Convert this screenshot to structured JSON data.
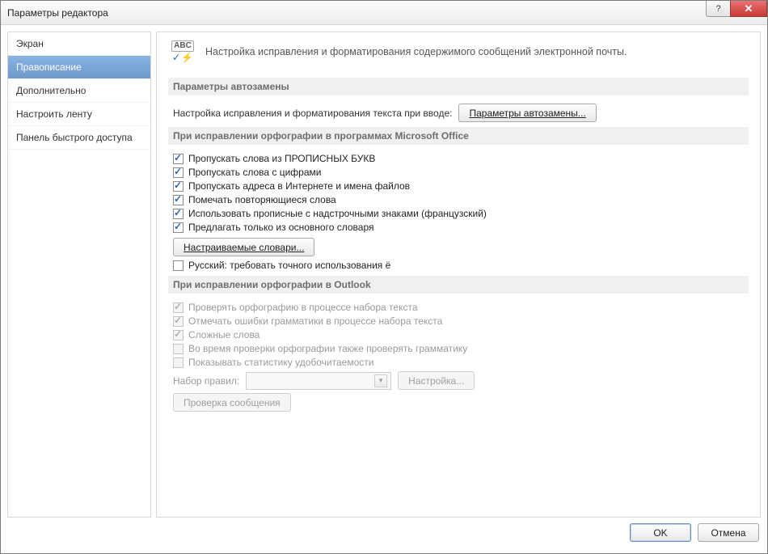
{
  "window": {
    "title": "Параметры редактора"
  },
  "sidebar": {
    "items": [
      {
        "label": "Экран"
      },
      {
        "label": "Правописание"
      },
      {
        "label": "Дополнительно"
      },
      {
        "label": "Настроить ленту"
      },
      {
        "label": "Панель быстрого доступа"
      }
    ]
  },
  "header": {
    "icon_label": "ABC",
    "text": "Настройка исправления и форматирования содержимого сообщений электронной почты."
  },
  "sections": {
    "autocorrect": {
      "title": "Параметры автозамены",
      "row_label": "Настройка исправления и форматирования текста при вводе:",
      "button": "Параметры автозамены..."
    },
    "office_spell": {
      "title": "При исправлении орфографии в программах Microsoft Office",
      "checks": [
        {
          "label": "Пропускать слова из ПРОПИСНЫХ БУКВ",
          "checked": true
        },
        {
          "label": "Пропускать слова с цифрами",
          "checked": true
        },
        {
          "label": "Пропускать адреса в Интернете и имена файлов",
          "checked": true
        },
        {
          "label": "Помечать повторяющиеся слова",
          "checked": true
        },
        {
          "label": "Использовать прописные с надстрочными знаками (французский)",
          "checked": true
        },
        {
          "label": "Предлагать только из основного словаря",
          "checked": true
        }
      ],
      "dict_button": "Настраиваемые словари...",
      "ru_strict": {
        "label": "Русский: требовать точного использования ё",
        "checked": false
      }
    },
    "outlook_spell": {
      "title": "При исправлении орфографии в Outlook",
      "checks": [
        {
          "label": "Проверять орфографию в процессе набора текста",
          "checked": true
        },
        {
          "label": "Отмечать ошибки грамматики в процессе набора текста",
          "checked": true
        },
        {
          "label": "Сложные слова",
          "checked": true
        },
        {
          "label": "Во время проверки орфографии также проверять грамматику",
          "checked": false
        },
        {
          "label": "Показывать статистику удобочитаемости",
          "checked": false
        }
      ],
      "ruleset_label": "Набор правил:",
      "settings_button": "Настройка...",
      "recheck_button": "Проверка сообщения"
    }
  },
  "footer": {
    "ok": "OK",
    "cancel": "Отмена"
  }
}
